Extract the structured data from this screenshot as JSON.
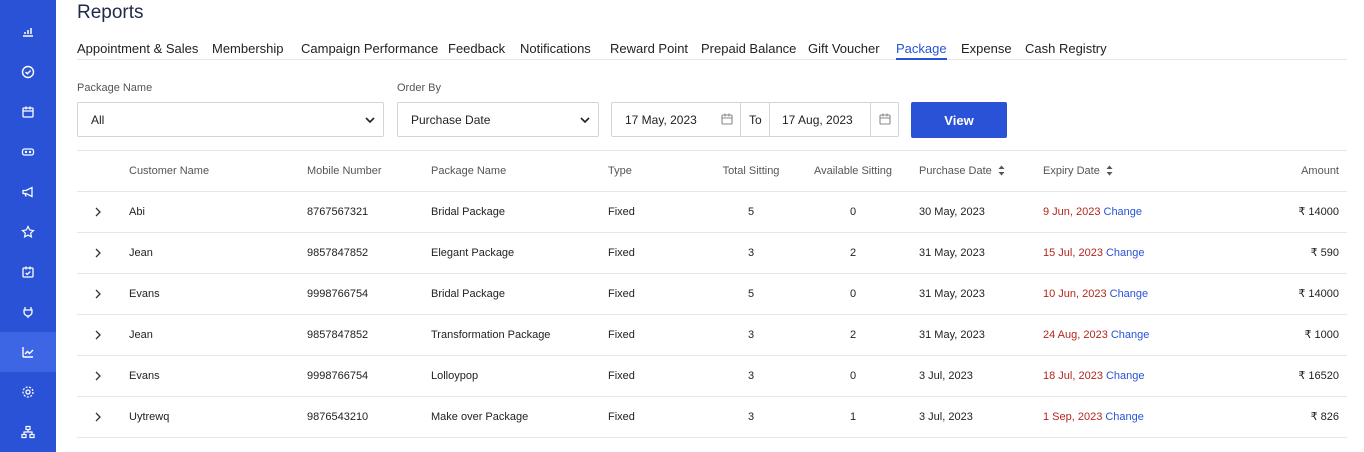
{
  "sidebar": {
    "items": [
      {
        "icon": "analytics-icon"
      },
      {
        "icon": "check-circle-icon"
      },
      {
        "icon": "calendar-icon"
      },
      {
        "icon": "membership-icon"
      },
      {
        "icon": "megaphone-icon"
      },
      {
        "icon": "star-icon"
      },
      {
        "icon": "calendar-check-icon"
      },
      {
        "icon": "wallet-icon"
      },
      {
        "icon": "reports-icon",
        "active": true
      },
      {
        "icon": "gear-icon"
      },
      {
        "icon": "org-chart-icon"
      }
    ],
    "bg": "#2952d6"
  },
  "page": {
    "title": "Reports"
  },
  "tabs": [
    {
      "label": "Appointment & Sales"
    },
    {
      "label": "Membership"
    },
    {
      "label": "Campaign Performance"
    },
    {
      "label": "Feedback"
    },
    {
      "label": "Notifications"
    },
    {
      "label": "Reward Point"
    },
    {
      "label": "Prepaid Balance"
    },
    {
      "label": "Gift Voucher"
    },
    {
      "label": "Package",
      "active": true
    },
    {
      "label": "Expense"
    },
    {
      "label": "Cash Registry"
    }
  ],
  "filters": {
    "package_label": "Package Name",
    "package_value": "All",
    "order_label": "Order By",
    "order_value": "Purchase Date",
    "date_from": "17 May, 2023",
    "to_label": "To",
    "date_to": "17 Aug, 2023",
    "view_label": "View"
  },
  "table": {
    "columns": {
      "customer": "Customer Name",
      "mobile": "Mobile Number",
      "package": "Package Name",
      "type": "Type",
      "total": "Total Sitting",
      "available": "Available Sitting",
      "purchase": "Purchase Date",
      "expiry": "Expiry Date",
      "amount": "Amount"
    },
    "change_label": "Change",
    "currency": "₹",
    "rows": [
      {
        "customer": "Abi",
        "mobile": "8767567321",
        "package": "Bridal Package",
        "type": "Fixed",
        "total": "5",
        "available": "0",
        "purchase": "30 May, 2023",
        "expiry": "9 Jun, 2023",
        "amount": "14000"
      },
      {
        "customer": "Jean",
        "mobile": "9857847852",
        "package": "Elegant Package",
        "type": "Fixed",
        "total": "3",
        "available": "2",
        "purchase": "31 May, 2023",
        "expiry": "15 Jul, 2023",
        "amount": "590"
      },
      {
        "customer": "Evans",
        "mobile": "9998766754",
        "package": "Bridal Package",
        "type": "Fixed",
        "total": "5",
        "available": "0",
        "purchase": "31 May, 2023",
        "expiry": "10 Jun, 2023",
        "amount": "14000"
      },
      {
        "customer": "Jean",
        "mobile": "9857847852",
        "package": "Transformation Package",
        "type": "Fixed",
        "total": "3",
        "available": "2",
        "purchase": "31 May, 2023",
        "expiry": "24 Aug, 2023",
        "amount": "1000"
      },
      {
        "customer": "Evans",
        "mobile": "9998766754",
        "package": "Lolloypop",
        "type": "Fixed",
        "total": "3",
        "available": "0",
        "purchase": "3 Jul, 2023",
        "expiry": "18 Jul, 2023",
        "amount": "16520"
      },
      {
        "customer": "Uytrewq",
        "mobile": "9876543210",
        "package": "Make over Package",
        "type": "Fixed",
        "total": "3",
        "available": "1",
        "purchase": "3 Jul, 2023",
        "expiry": "1 Sep, 2023",
        "amount": "826"
      }
    ]
  },
  "colors": {
    "accent": "#2952d6",
    "expired": "#b3261e"
  }
}
